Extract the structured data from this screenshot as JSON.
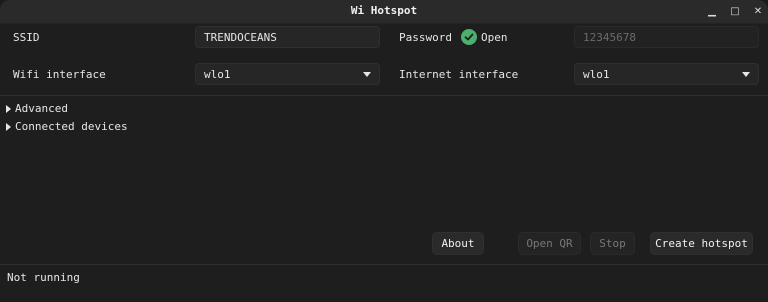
{
  "window": {
    "title": "Wi Hotspot",
    "controls": {
      "minimize": "▁",
      "maximize": "□",
      "close": "✕"
    }
  },
  "form": {
    "ssid": {
      "label": "SSID",
      "value": "TRENDOCEANS"
    },
    "password": {
      "label": "Password",
      "open_label": "Open",
      "placeholder": "12345678"
    },
    "wifi_interface": {
      "label": "Wifi interface",
      "value": "wlo1"
    },
    "internet_interface": {
      "label": "Internet interface",
      "value": "wlo1"
    }
  },
  "sections": {
    "advanced": "Advanced",
    "connected_devices": "Connected devices"
  },
  "buttons": {
    "about": "About",
    "open_qr": "Open QR",
    "stop": "Stop",
    "create_hotspot": "Create hotspot"
  },
  "status": "Not running",
  "colors": {
    "accent_green": "#4caf6e",
    "background": "#1e1e1e"
  }
}
